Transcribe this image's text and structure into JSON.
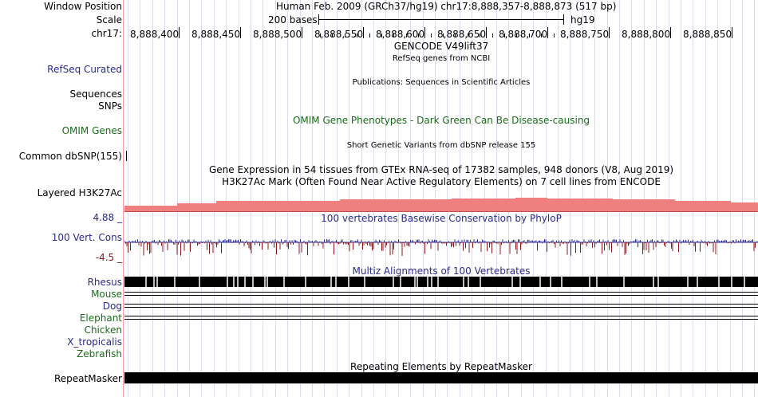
{
  "colors": {
    "label_blue": "#2a2a8c",
    "label_green": "#1a6b1a",
    "conservation_blue": "#31319c",
    "conservation_red": "#8a1a1a",
    "h3k27ac_fill": "#f08080",
    "track_black": "#000000",
    "divider": "#f0a0a0"
  },
  "header": {
    "window_position_label": "Window Position",
    "window_position_value": "Human Feb. 2009 (GRCh37/hg19)   chr17:8,888,357-8,888,873 (517 bp)",
    "scale_label": "Scale",
    "scale_bar_text": "200 bases",
    "scale_assembly": "hg19",
    "chrom_label": "chr17:",
    "ruler_ticks": [
      "8,888,400",
      "8,888,450",
      "8,888,500",
      "8,888,550",
      "8,888,600",
      "8,888,650",
      "8,888,700",
      "8,888,750",
      "8,888,800",
      "8,888,850"
    ]
  },
  "tracks": {
    "gencode_title": "GENCODE V49lift37",
    "refseq_desc": "RefSeq genes from NCBI",
    "refseq_label": "RefSeq Curated",
    "publications_desc": "Publications: Sequences in Scientific Articles",
    "sequences_label": "Sequences",
    "snps_label": "SNPs",
    "omim_desc": "OMIM Gene Phenotypes - Dark Green Can Be Disease-causing",
    "omim_label": "OMIM Genes",
    "dbsnp_desc": "Short Genetic Variants from dbSNP release 155",
    "dbsnp_label": "Common dbSNP(155)",
    "gtex_desc": "Gene Expression in 54 tissues from GTEx RNA-seq of 17382 samples, 948 donors (V8, Aug 2019)",
    "h3k27ac_desc": "H3K27Ac Mark (Often Found Near Active Regulatory Elements) on 7 cell lines from ENCODE",
    "h3k27ac_label": "Layered H3K27Ac",
    "cons_max": "4.88 _",
    "cons_desc": "100 vertebrates Basewise Conservation by PhyloP",
    "cons_label": "100 Vert. Cons",
    "cons_min": "-4.5 _",
    "multiz_desc": "Multiz Alignments of 100 Vertebrates",
    "species": [
      "Rhesus",
      "Mouse",
      "Dog",
      "Elephant",
      "Chicken",
      "X_tropicalis",
      "Zebrafish"
    ],
    "repeat_desc": "Repeating Elements by RepeatMasker",
    "repeat_label": "RepeatMasker"
  }
}
